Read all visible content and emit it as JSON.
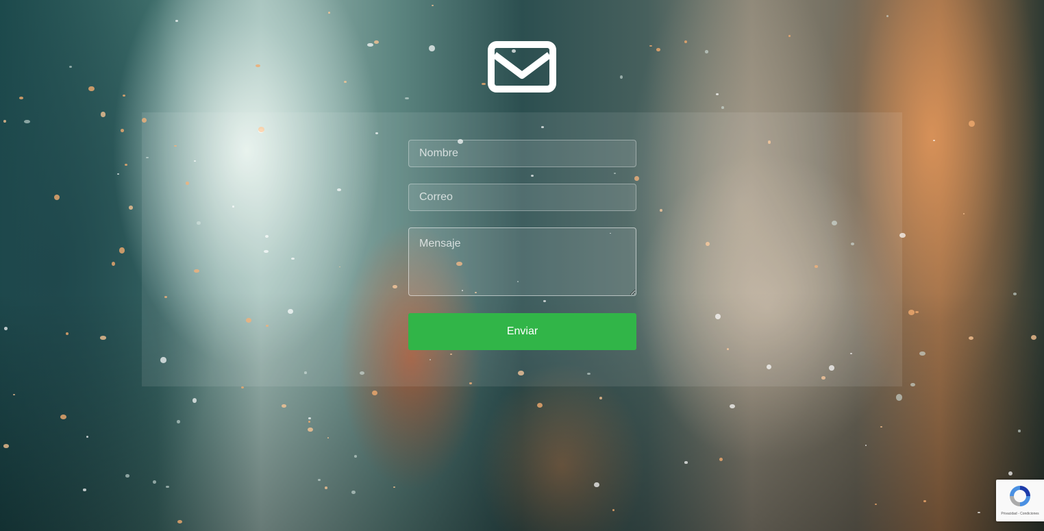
{
  "form": {
    "name_placeholder": "Nombre",
    "email_placeholder": "Correo",
    "message_placeholder": "Mensaje",
    "submit_label": "Enviar"
  },
  "recaptcha": {
    "links": "Privacidad - Condiciones"
  },
  "colors": {
    "submit_button": "#31b548",
    "logo": "#ffffff"
  },
  "icons": {
    "logo": "envelope-icon",
    "recaptcha": "recaptcha-icon"
  }
}
